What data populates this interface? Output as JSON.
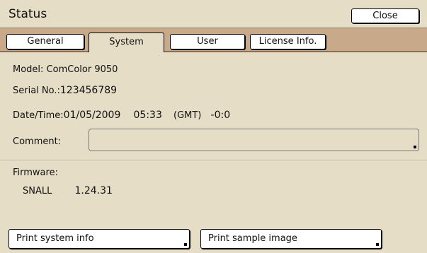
{
  "window": {
    "title": "Status",
    "close_label": "Close"
  },
  "tabs": [
    {
      "label": "General",
      "active": false
    },
    {
      "label": "System",
      "active": true
    },
    {
      "label": "User",
      "active": false
    },
    {
      "label": "License Info.",
      "active": false
    }
  ],
  "system": {
    "model_label": "Model:",
    "model_value": "ComColor 9050",
    "serial_label": "Serial No.:",
    "serial_value": "123456789",
    "datetime_label": "Date/Time:",
    "date_value": "01/05/2009",
    "time_value": "05:33",
    "tz_label": "(GMT)",
    "tz_offset": "-0:0",
    "comment_label": "Comment:",
    "comment_value": "",
    "firmware_label": "Firmware:",
    "firmware_name": "SNALL",
    "firmware_version": "1.24.31"
  },
  "actions": {
    "print_system_info": "Print system info",
    "print_sample_image": "Print sample image"
  }
}
